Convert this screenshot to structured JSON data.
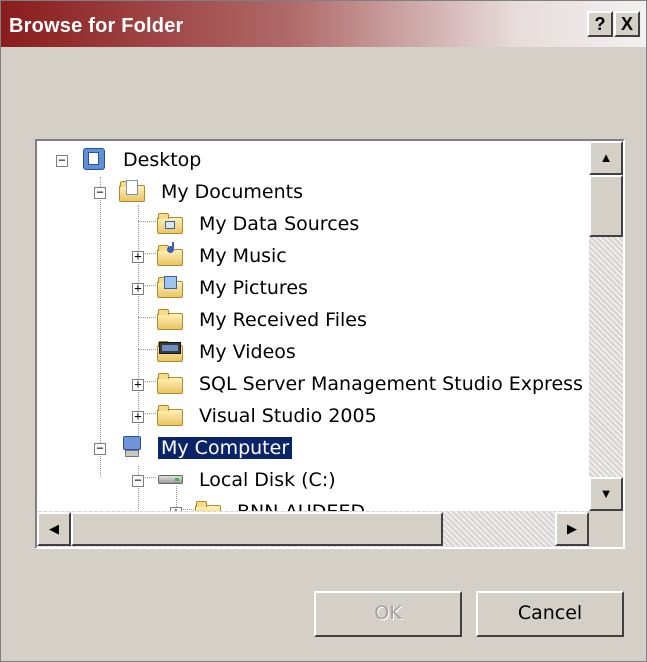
{
  "window": {
    "title": "Browse for Folder",
    "help_label": "?",
    "close_label": "X"
  },
  "tree": {
    "items": [
      {
        "label": "Desktop",
        "icon": "desktop-icon",
        "expander": "−"
      },
      {
        "label": "My Documents",
        "icon": "my-documents-icon",
        "expander": "−"
      },
      {
        "label": "My Data Sources",
        "icon": "data-sources-folder-icon"
      },
      {
        "label": "My Music",
        "icon": "music-folder-icon",
        "expander": "+"
      },
      {
        "label": "My Pictures",
        "icon": "pictures-folder-icon",
        "expander": "+"
      },
      {
        "label": "My Received Files",
        "icon": "folder-icon"
      },
      {
        "label": "My Videos",
        "icon": "videos-folder-icon"
      },
      {
        "label": "SQL Server Management Studio Express",
        "icon": "folder-icon",
        "expander": "+"
      },
      {
        "label": "Visual Studio 2005",
        "icon": "folder-icon",
        "expander": "+"
      },
      {
        "label": "My Computer",
        "icon": "computer-icon",
        "expander": "−",
        "selected": true
      },
      {
        "label": "Local Disk (C:)",
        "icon": "drive-icon",
        "expander": "−"
      },
      {
        "label": "BNN-AUDEED",
        "icon": "folder-icon",
        "expander": "+"
      }
    ]
  },
  "scrollbars": {
    "up": "▲",
    "down": "▼",
    "left": "◀",
    "right": "▶"
  },
  "buttons": {
    "ok": "OK",
    "cancel": "Cancel"
  },
  "colors": {
    "title_start": "#8a1c1c",
    "selection": "#0a246a",
    "face": "#d4d0c8"
  }
}
